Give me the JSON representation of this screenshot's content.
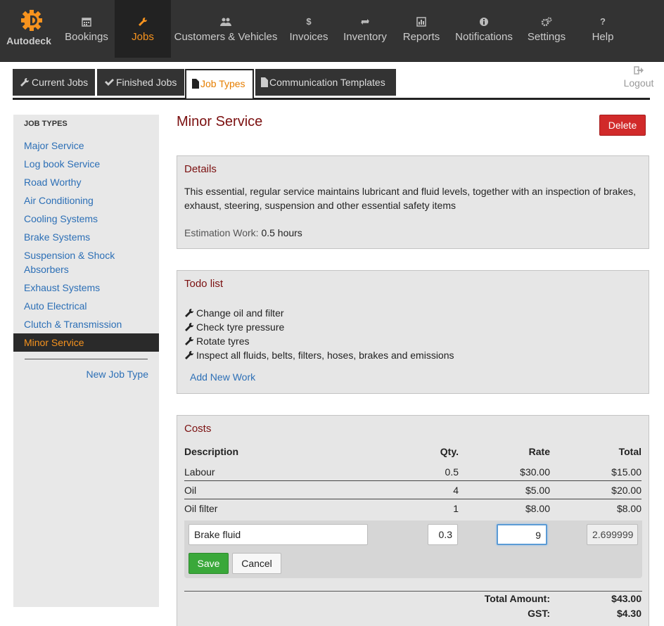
{
  "brand": {
    "name": "Autodeck"
  },
  "nav": [
    {
      "label": "Bookings",
      "icon": "calendar-icon"
    },
    {
      "label": "Jobs",
      "icon": "wrench-icon"
    },
    {
      "label": "Customers & Vehicles",
      "icon": "users-icon"
    },
    {
      "label": "Invoices",
      "icon": "dollar-icon"
    },
    {
      "label": "Inventory",
      "icon": "retweet-icon"
    },
    {
      "label": "Reports",
      "icon": "bar-chart-icon"
    },
    {
      "label": "Notifications",
      "icon": "info-icon"
    },
    {
      "label": "Settings",
      "icon": "cogs-icon"
    },
    {
      "label": "Help",
      "icon": "question-icon"
    }
  ],
  "subtabs": [
    {
      "label": "Current Jobs"
    },
    {
      "label": "Finished Jobs"
    },
    {
      "label": "Job Types"
    },
    {
      "label": "Communication Templates"
    }
  ],
  "logout": "Logout",
  "sidebar": {
    "heading": "JOB TYPES",
    "items": [
      "Major Service",
      "Log book Service",
      "Road Worthy",
      "Air Conditioning",
      "Cooling Systems",
      "Brake Systems",
      "Suspension & Shock Absorbers",
      "Exhaust Systems",
      "Auto Electrical",
      "Clutch & Transmission",
      "Minor Service"
    ],
    "new_link": "New Job Type"
  },
  "page": {
    "title": "Minor Service",
    "delete_label": "Delete"
  },
  "details": {
    "heading": "Details",
    "description": "This essential, regular service maintains lubricant and fluid levels, together with an inspection of brakes, exhaust, steering, suspension and other essential safety items",
    "estimation_label": "Estimation Work:",
    "estimation_value": "0.5 hours"
  },
  "todo": {
    "heading": "Todo list",
    "items": [
      "Change oil and filter",
      "Check tyre pressure",
      "Rotate tyres",
      "Inspect all fluids, belts, filters, hoses, brakes and emissions"
    ],
    "add_label": "Add New Work"
  },
  "costs": {
    "heading": "Costs",
    "columns": {
      "description": "Description",
      "qty": "Qty.",
      "rate": "Rate",
      "total": "Total"
    },
    "rows": [
      {
        "description": "Labour",
        "qty": "0.5",
        "rate": "$30.00",
        "total": "$15.00"
      },
      {
        "description": "Oil",
        "qty": "4",
        "rate": "$5.00",
        "total": "$20.00"
      },
      {
        "description": "Oil filter",
        "qty": "1",
        "rate": "$8.00",
        "total": "$8.00"
      }
    ],
    "edit": {
      "description": "Brake fluid",
      "qty": "0.3",
      "rate": "9",
      "total": "2.699999"
    },
    "save_label": "Save",
    "cancel_label": "Cancel",
    "total_amount_label": "Total Amount:",
    "total_amount": "$43.00",
    "gst_label": "GST:",
    "gst": "$4.30"
  },
  "colors": {
    "accent": "#f7931e",
    "title": "#7b1010",
    "link": "#2c6fb6",
    "danger": "#d12a2a",
    "success": "#3aa83a"
  }
}
